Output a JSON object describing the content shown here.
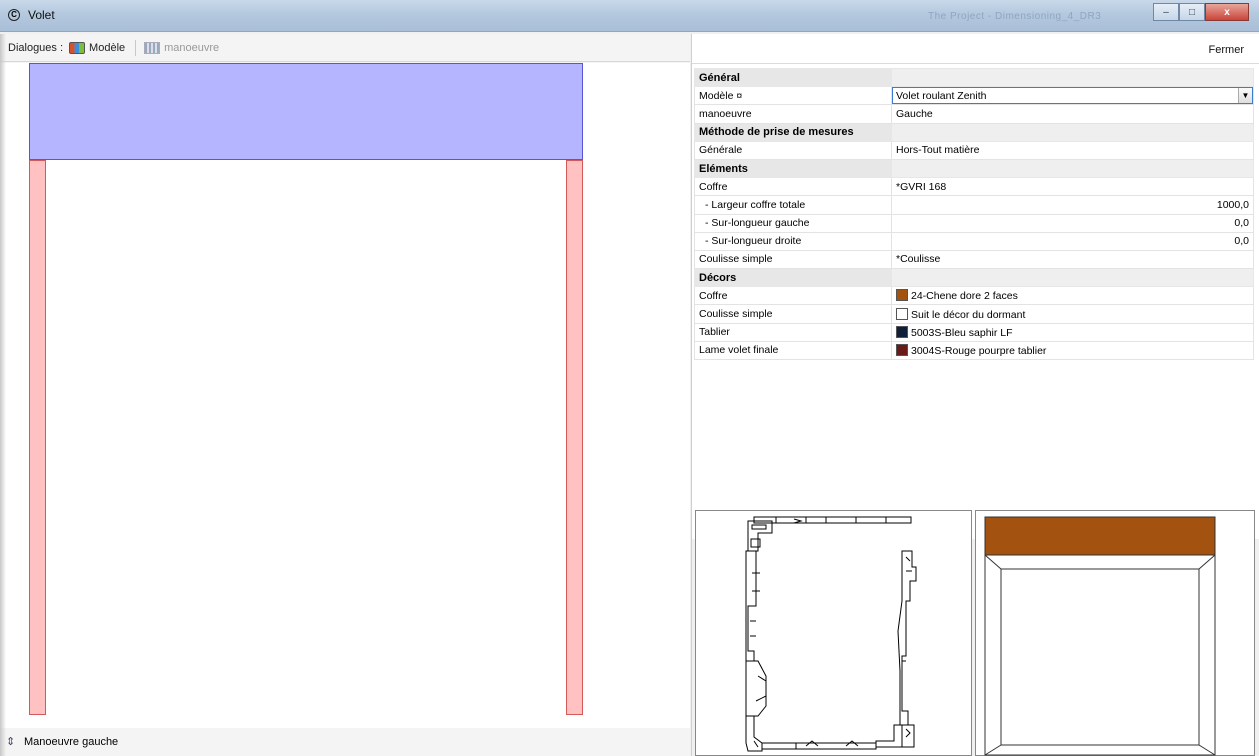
{
  "window": {
    "title": "Volet",
    "background_title": "The Project - Dimensioning_4_DR3",
    "minimize_label": "–",
    "maximize_label": "□",
    "close_label": "x"
  },
  "toolbar": {
    "label": "Dialogues :",
    "model_button": "Modèle",
    "maneuver_button": "manoeuvre"
  },
  "right_header": {
    "close_label": "Fermer"
  },
  "status": {
    "text": "Manoeuvre gauche",
    "icon": "updown-arrows-icon"
  },
  "drawing": {
    "coffre_color": "#b5b5ff",
    "coulisse_color": "#ffc1c1"
  },
  "properties": {
    "sections": [
      {
        "title": "Général"
      },
      {
        "title": "Méthode de prise de mesures"
      },
      {
        "title": "Eléments"
      },
      {
        "title": "Décors"
      }
    ],
    "general": {
      "model_label": "Modèle ¤",
      "model_value": "Volet roulant Zenith",
      "maneuver_label": "manoeuvre",
      "maneuver_value": "Gauche"
    },
    "measure": {
      "label": "Générale",
      "value": "Hors-Tout matière"
    },
    "elements": {
      "coffre_label": "Coffre",
      "coffre_value": "*GVRI 168",
      "largeur_label": "- Largeur coffre totale",
      "largeur_value": "1000,0",
      "sur_gauche_label": "- Sur-longueur gauche",
      "sur_gauche_value": "0,0",
      "sur_droite_label": "- Sur-longueur droite",
      "sur_droite_value": "0,0",
      "coulisse_label": "Coulisse simple",
      "coulisse_value": "*Coulisse"
    },
    "decors": [
      {
        "label": "Coffre",
        "value": "24-Chene dore 2 faces",
        "color": "#a3520f"
      },
      {
        "label": "Coulisse simple",
        "value": "Suit le décor du dormant",
        "color": "#ffffff"
      },
      {
        "label": "Tablier",
        "value": "5003S-Bleu saphir LF",
        "color": "#0f1f3a"
      },
      {
        "label": "Lame volet finale",
        "value": "3004S-Rouge pourpre tablier",
        "color": "#6b1a1a"
      }
    ]
  },
  "preview_facade": {
    "coffre_color": "#a3520f"
  }
}
